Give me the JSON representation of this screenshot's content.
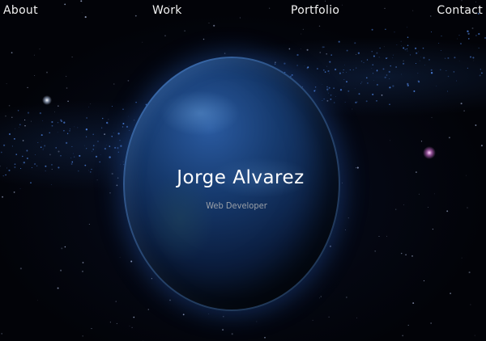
{
  "nav": {
    "items": [
      {
        "label": "About"
      },
      {
        "label": "Work"
      },
      {
        "label": "Portfolio"
      },
      {
        "label": "Contact"
      }
    ]
  },
  "hero": {
    "name": "Jorge Alvarez",
    "role": "Web Developer"
  },
  "colors": {
    "background": "#020308",
    "nav_text": "#f2f2f2",
    "title_text": "#ffffff",
    "subtitle_text": "#9aa0a8",
    "planet_blue": "#2a5aa0"
  }
}
